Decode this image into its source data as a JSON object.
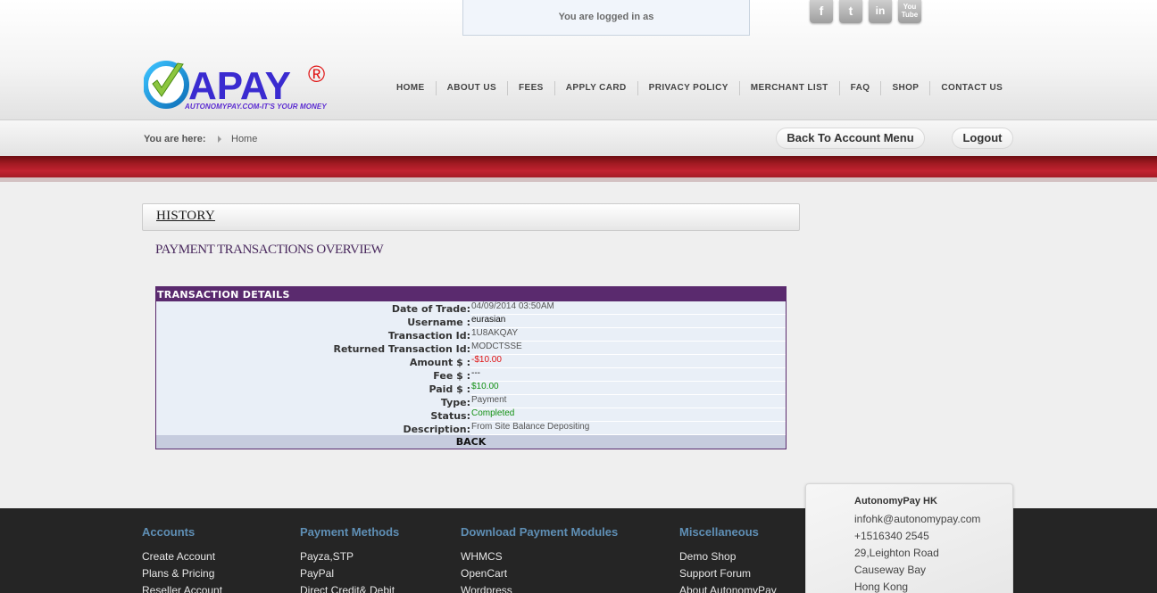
{
  "header": {
    "login_text": "You are logged in as",
    "social": {
      "facebook": "f",
      "twitter": "t",
      "linkedin": "in",
      "youtube": "You Tube"
    },
    "logo": {
      "text": "APAY",
      "registered": "®",
      "tagline": "AUTONOMYPAY.COM-IT'S YOUR MONEY"
    },
    "nav": [
      "HOME",
      "ABOUT US",
      "FEES",
      "APPLY CARD",
      "PRIVACY POLICY",
      "MERCHANT LIST",
      "FAQ",
      "SHOP",
      "CONTACT US"
    ]
  },
  "breadcrumb": {
    "label": "You are here:",
    "current": "Home",
    "back_button": "Back To Account Menu",
    "logout_button": "Logout"
  },
  "content": {
    "section_title": "HISTORY",
    "subtitle": "PAYMENT TRANSACTIONS OVERVIEW",
    "table": {
      "header": "TRANSACTION DETAILS",
      "rows": [
        {
          "label": "Date of Trade:",
          "value": "04/09/2014 03:50AM"
        },
        {
          "label": "Username :",
          "value": "eurasian"
        },
        {
          "label": "Transaction Id:",
          "value": "1U8AKQAY"
        },
        {
          "label": "Returned Transaction Id:",
          "value": "MODCTSSE"
        },
        {
          "label": "Amount $ :",
          "value": "-$10.00"
        },
        {
          "label": "Fee $ :",
          "value": "---"
        },
        {
          "label": "Paid $ :",
          "value": "$10.00"
        },
        {
          "label": "Type:",
          "value": "Payment"
        },
        {
          "label": "Status:",
          "value": "Completed"
        },
        {
          "label": "Description:",
          "value": "From Site Balance Depositing"
        }
      ],
      "back": "BACK"
    }
  },
  "footer": {
    "columns": [
      {
        "title": "Accounts",
        "links": [
          "Create Account",
          "Plans & Pricing",
          "Reseller Account"
        ]
      },
      {
        "title": "Payment Methods",
        "links": [
          "Payza,STP",
          "PayPal",
          "Direct Credit& Debit"
        ]
      },
      {
        "title": "Download Payment Modules",
        "links": [
          "WHMCS",
          "OpenCart",
          "Wordpress"
        ]
      },
      {
        "title": "Miscellaneous",
        "links": [
          "Demo Shop",
          "Support Forum",
          "About AutonomyPay"
        ]
      }
    ],
    "contact": {
      "title": "AutonomyPay HK",
      "lines": [
        "infohk@autonomypay.com",
        "+1516340 2545",
        "29,Leighton Road",
        "Causeway Bay",
        "Hong Kong"
      ]
    }
  },
  "colors": {
    "accent_purple": "#5a2a6e",
    "red_band": "#a11a22",
    "footer_bg": "#252525",
    "footer_head": "#5f8fb5"
  }
}
